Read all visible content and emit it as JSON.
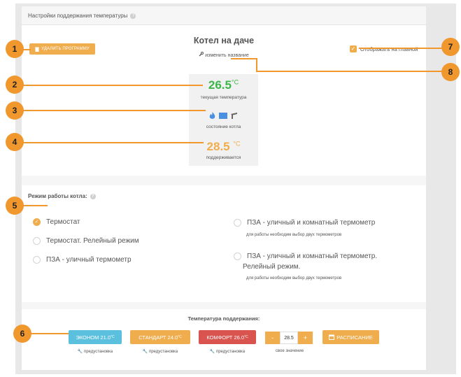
{
  "header": {
    "title": "Настройки поддержания температуры",
    "help_icon": "?"
  },
  "toolbar": {
    "delete_label": "УДАЛИТЬ ПРОГРАММУ"
  },
  "boiler": {
    "name": "Котел на даче",
    "rename_label": "изменить название"
  },
  "show_on_main": {
    "label": "Отображать на главной",
    "checked": true
  },
  "status": {
    "current_temp": "26.5",
    "temp_unit": "°C",
    "current_label": "текущая температура",
    "state_label": "состояние котла",
    "set_temp": "28.5",
    "set_label": "поддерживается"
  },
  "mode": {
    "title": "Режим работы котла:",
    "options": [
      {
        "label": "Термостат",
        "selected": true
      },
      {
        "label": "Термостат. Релейный режим",
        "selected": false
      },
      {
        "label": "ПЗА - уличный термометр",
        "selected": false
      },
      {
        "label": "ПЗА - уличный и комнатный термометр",
        "selected": false,
        "note": "для работы необходим выбор двух термометров"
      },
      {
        "label": "ПЗА - уличный и комнатный термометр.",
        "label2": "Релейный режим.",
        "selected": false,
        "note": "для работы необходим выбор двух термометров"
      }
    ]
  },
  "maintain": {
    "title": "Температура поддержания:",
    "presets": [
      {
        "label": "ЭКОНОМ 21.0",
        "sub": "предустановка",
        "color": "#5bc0de"
      },
      {
        "label": "СТАНДАРТ 24.0",
        "sub": "предустановка",
        "color": "#f0ad4e"
      },
      {
        "label": "КОМФОРТ 26.0",
        "sub": "предустановка",
        "color": "#d9534f"
      }
    ],
    "preset_unit": "°C",
    "stepper": {
      "minus": "-",
      "value": "28.5",
      "plus": "+",
      "label": "свое значение"
    },
    "schedule_label": "РАСПИСАНИЕ"
  },
  "callouts": [
    "1",
    "2",
    "3",
    "4",
    "5",
    "6",
    "7",
    "8"
  ],
  "colors": {
    "accent": "#f0ad4e",
    "green": "#3cb54a",
    "callout": "#f0972e"
  }
}
